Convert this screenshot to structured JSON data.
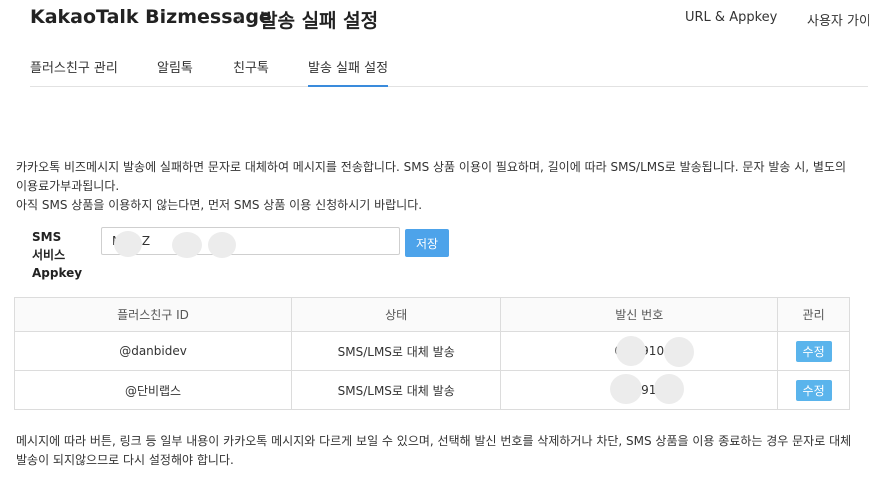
{
  "header": {
    "brand": "KakaoTalk Bizmessage",
    "separator": "›",
    "page": "발송 실패 설정",
    "links": [
      "URL & Appkey",
      "사용자 가이"
    ]
  },
  "tabs": [
    {
      "label": "플러스친구 관리"
    },
    {
      "label": "알림톡"
    },
    {
      "label": "친구톡"
    },
    {
      "label": "발송 실패 설정"
    }
  ],
  "description": {
    "line1": "카카오톡 비즈메시지 발송에 실패하면 문자로 대체하여 메시지를 전송합니다. SMS 상품 이용이 필요하며, 길이에 따라 SMS/LMS로 발송됩니다. 문자 발송 시, 별도의 이용료가부과됩니다.",
    "line2": "아직 SMS 상품을 이용하지 않는다면, 먼저 SMS 상품 이용 신청하시기 바랍니다."
  },
  "appkey": {
    "label_line1": "SMS",
    "label_line2": "서비스",
    "label_line3": "Appkey",
    "value": "Mdti Z",
    "save_label": "저장"
  },
  "table": {
    "headers": [
      "플러스친구 ID",
      "상태",
      "발신 번호",
      "관리"
    ],
    "rows": [
      {
        "id": "@danbidev",
        "status": "SMS/LMS로 대체 발송",
        "number": "070 910",
        "action": "수정"
      },
      {
        "id": "@단비랩스",
        "status": "SMS/LMS로 대체 발송",
        "number": "07 91",
        "action": "수정"
      }
    ]
  },
  "footnote": "메시지에 따라 버튼, 링크 등 일부 내용이 카카오톡 메시지와 다르게 보일 수 있으며, 선택해 발신 번호를 삭제하거나 차단, SMS 상품을 이용 종료하는 경우 문자로 대체 발송이 되지않으므로 다시 설정해야 합니다."
}
